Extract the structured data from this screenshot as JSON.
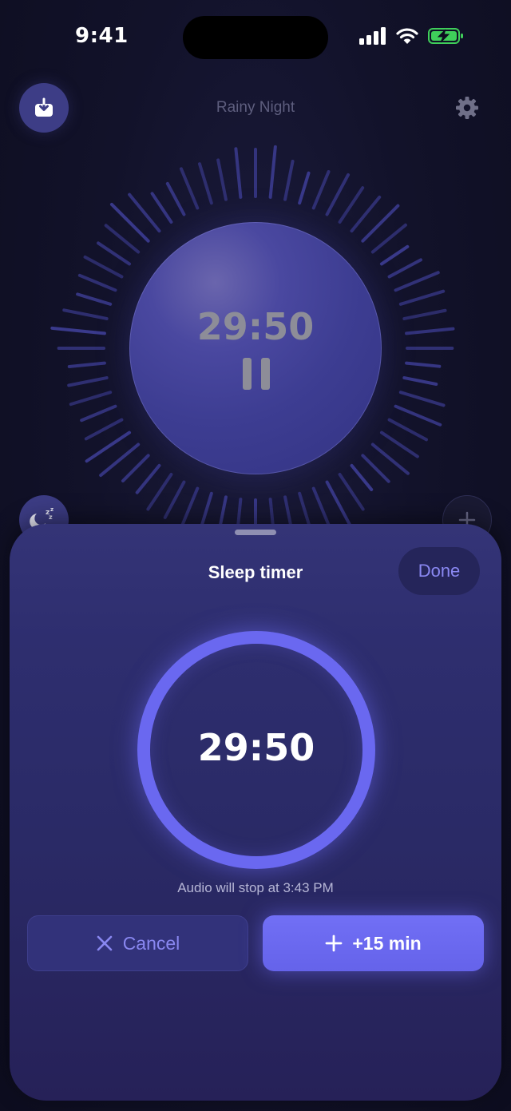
{
  "status_bar": {
    "time": "9:41",
    "icons": [
      "cellular-signal-icon",
      "wifi-icon",
      "battery-charging-icon"
    ]
  },
  "player": {
    "track_title": "Rainy Night",
    "remaining_time": "29:50",
    "state_icon": "pause-icon",
    "buttons": {
      "download": "download-icon",
      "settings": "gear-icon",
      "sleep": "moon-zzz-icon",
      "add": "plus-icon"
    }
  },
  "sheet": {
    "title": "Sleep timer",
    "done_label": "Done",
    "timer_value": "29:50",
    "stop_note": "Audio will stop at 3:43 PM",
    "cancel_label": "Cancel",
    "extend_label": "+15 min"
  },
  "colors": {
    "accent": "#6a68f0",
    "background": "#12122a",
    "sheet": "#2e2e6f",
    "muted_text": "#8d8d98"
  }
}
